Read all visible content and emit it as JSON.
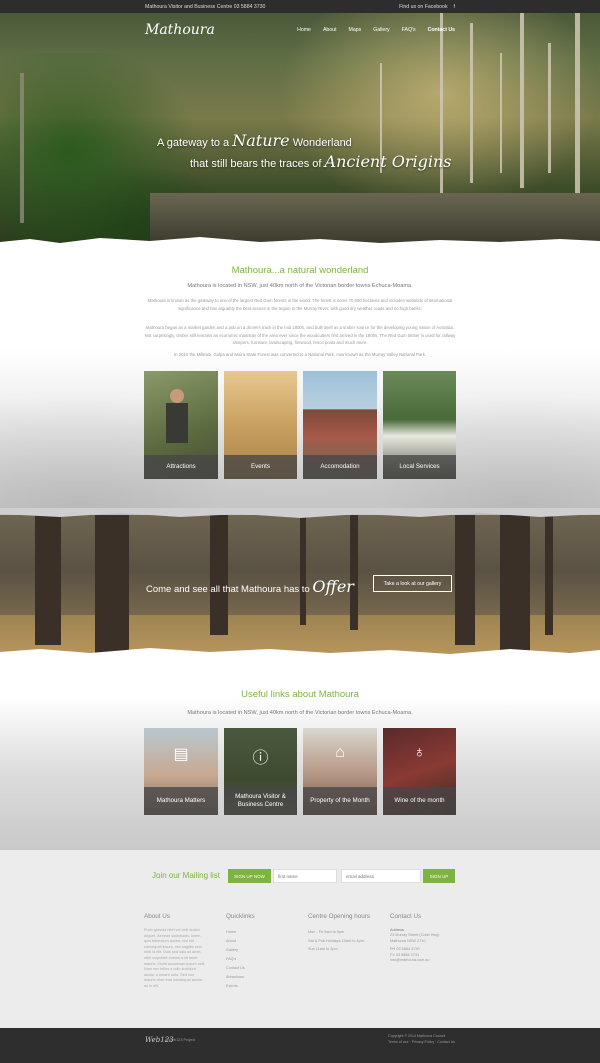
{
  "topbar": {
    "contact": "Mathoura Visitor and Business Centre 03 5884 3730",
    "facebook": "Find us on Facebook"
  },
  "brand": {
    "logo": "Mathoura"
  },
  "nav": [
    "Home",
    "About",
    "Maps",
    "Gallery",
    "FAQ's",
    "Contact Us"
  ],
  "hero": {
    "line1_pre": "A gateway to a",
    "line1_script": "Nature",
    "line1_post": "Wonderland",
    "line2_pre": "that still bears the traces of",
    "line2_script": "Ancient Origins"
  },
  "intro": {
    "heading": "Mathoura...a natural wonderland",
    "lead": "Mathoura is located in NSW, just 40km north of the Victorian border towns Echuca-Moama.",
    "p1": "Mathoura is known as the gateway to one of the largest Red Gum forests in the world. The forest is some 70,000 hectares and includes wetlands of international significance and has arguably the best access in the region to the Murray River, with good dry weather roads and no high banks.",
    "p2": "Mathoura began as a market garden and a pub on a drovers track in the mid 1800s, and built itself as a timber source for the developing young nation of Australia. Not surprisingly, timber still remains an economic mainstay of the area ever since the woodcutters first arrived in the 1800s. The Red Gum timber is used for railway sleepers, furniture, landscaping, firewood, fence posts and much more.",
    "p3": "In 2010 the Millewa, Gulpa and Moira State Forest was converted to a National Park, now known as the Murray Valley National Park."
  },
  "tiles1": [
    "Attractions",
    "Events",
    "Accomodation",
    "Local Services"
  ],
  "band": {
    "msg_pre": "Come and see all that Mathoura has to",
    "msg_script": "Offer",
    "button": "Take a look at our gallery"
  },
  "useful": {
    "heading": "Useful links about Mathoura",
    "lead": "Mathoura is located in NSW, just 40km north of the Victorian border towns Echuca-Moama."
  },
  "tiles2": [
    "Mathoura Matters",
    "Mathoura Visitor & Business Centre",
    "Property of the Month",
    "Wine of the month"
  ],
  "mailing": {
    "label": "Join our Mailing list",
    "signup": "SIGN UP NOW",
    "name_placeholder": "first name",
    "email_placeholder": "email address",
    "submit": "SIGN UP"
  },
  "footer": {
    "about_title": "About Us",
    "about_text": "Proin gravida nibh vel velit auctor aliquet. Aenean sollicitudin, lorem quis bibendum auctor, nisi elit consequat ipsum, nec sagittis sem nibh id elit. Duis sed odio sit amet nibh vulputate cursus a sit amet mauris. Morbi accumsan ipsum velit. Nam nec tellus a odio tincidunt auctor a ornare odio. Sed non mauris vitae erat consequat auctor eu in elit.",
    "quick_title": "Quicklinks",
    "quick": [
      "Home",
      "About",
      "Gallery",
      "FAQ's",
      "Contact Us",
      "Attractions",
      "Events"
    ],
    "hours_title": "Centre Opening hours",
    "hours": [
      "Mon - Fri 9am to 5pm",
      "Sat & Pub Holidays 10am to 4pm",
      "Sun 11am to 3pm"
    ],
    "contact_title": "Contact Us",
    "address_label": "Address",
    "address": [
      "23 Murray Street (Cobb Hwy)",
      "Mathoura NSW 2710"
    ],
    "ph": "PH 03 5884 3730",
    "fax": "FX 03 5884 3731",
    "email": "info@mathoura.com.au"
  },
  "bottom": {
    "logo": "Web123",
    "by": "A Web123 Project",
    "copy1": "Copyright © 2014 Mathoura Council",
    "copy2": "Terms of use  ·  Privacy Policy  ·  Contact Us"
  }
}
